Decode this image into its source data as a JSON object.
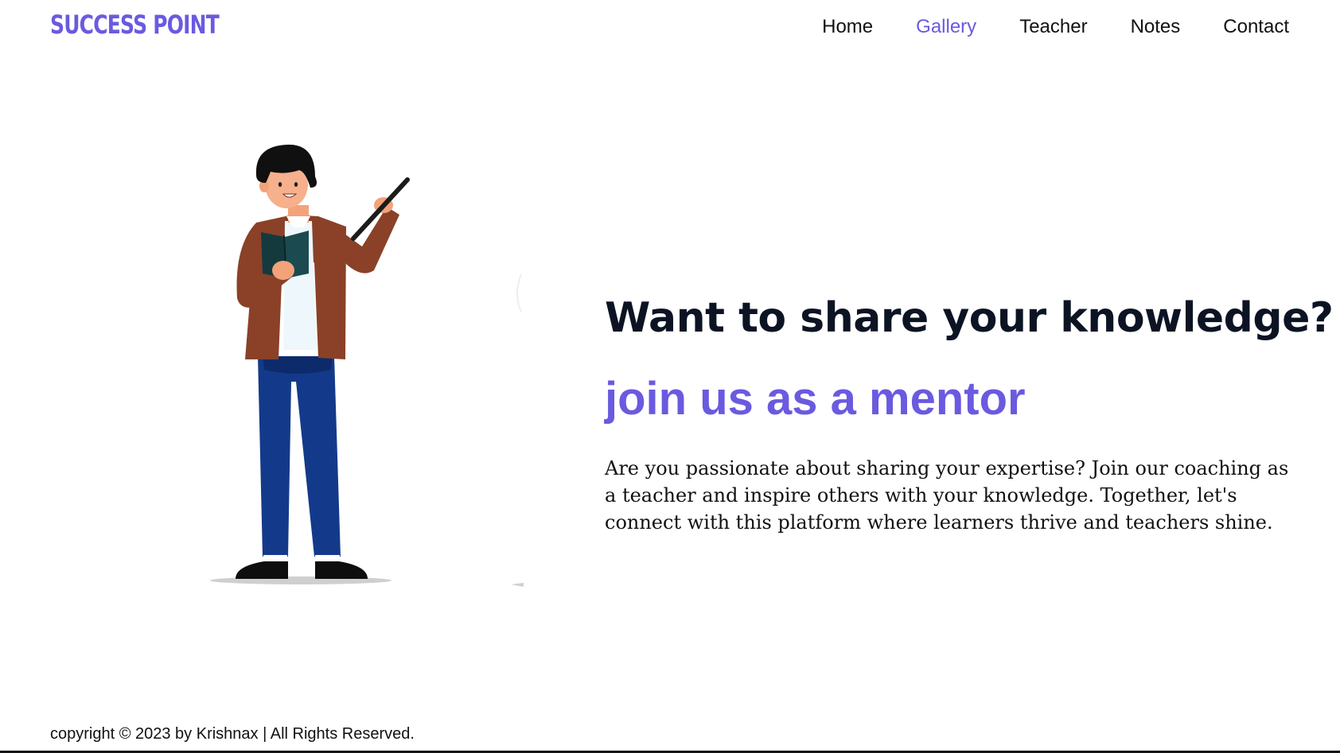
{
  "brand": {
    "logo_text": "SUCCESS POINT",
    "accent_color": "#6a5ae0"
  },
  "nav": {
    "items": [
      {
        "label": "Home",
        "active": false
      },
      {
        "label": "Gallery",
        "active": true
      },
      {
        "label": "Teacher",
        "active": false
      },
      {
        "label": "Notes",
        "active": false
      },
      {
        "label": "Contact",
        "active": false
      }
    ]
  },
  "hero": {
    "headline": "Want to share your knowledge?",
    "subheadline": "join us as a mentor",
    "description": "Are you passionate about sharing your expertise? Join our coaching as a teacher and inspire others with your knowledge. Together, let's connect with this platform where learners thrive and teachers shine.",
    "illustration": "teacher-with-pointer-illustration"
  },
  "footer": {
    "copyright": "copyright © 2023 by Krishnax | All Rights Reserved."
  }
}
